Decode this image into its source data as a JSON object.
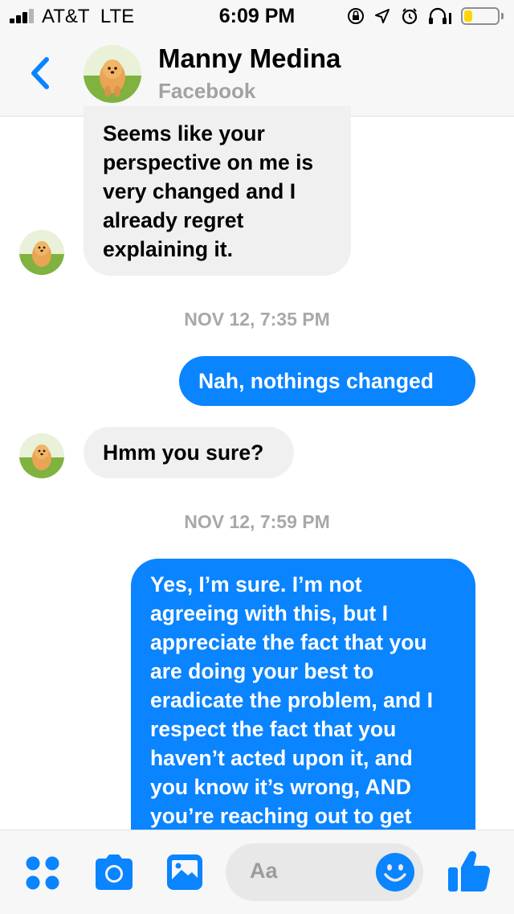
{
  "status_bar": {
    "carrier": "AT&T",
    "network": "LTE",
    "time": "6:09 PM",
    "battery_level": 0.25,
    "icons": [
      "signal-bars-icon",
      "screen-lock-icon",
      "location-arrow-icon",
      "alarm-clock-icon",
      "headphones-icon",
      "battery-icon"
    ]
  },
  "header": {
    "back_icon": "chevron-left-icon",
    "contact_name": "Manny Medina",
    "contact_source": "Facebook"
  },
  "colors": {
    "accent": "#0a84ff",
    "incoming_bubble": "#f0f0f0",
    "outgoing_bubble": "#0a84ff",
    "timestamp": "#a8a8a8"
  },
  "messages": [
    {
      "direction": "incoming",
      "text": "Seems like your perspective on me is very changed and I already regret explaining it."
    },
    {
      "type": "timestamp",
      "text": "NOV 12, 7:35 PM"
    },
    {
      "direction": "outgoing",
      "text": "Nah, nothings changed"
    },
    {
      "direction": "incoming",
      "text": "Hmm you sure?"
    },
    {
      "type": "timestamp",
      "text": "NOV 12, 7:59 PM"
    },
    {
      "direction": "outgoing",
      "text": "Yes, I’m sure. I’m not agreeing with this, but I appreciate the fact that you are doing your best to eradicate the problem, and I respect the fact that you haven’t acted upon it, and you know it’s wrong, AND you’re reaching out to get"
    }
  ],
  "composer": {
    "placeholder": "Aa",
    "icons": [
      "apps-grid-icon",
      "camera-icon",
      "photo-gallery-icon",
      "emoji-smiley-icon",
      "thumbs-up-icon"
    ]
  }
}
